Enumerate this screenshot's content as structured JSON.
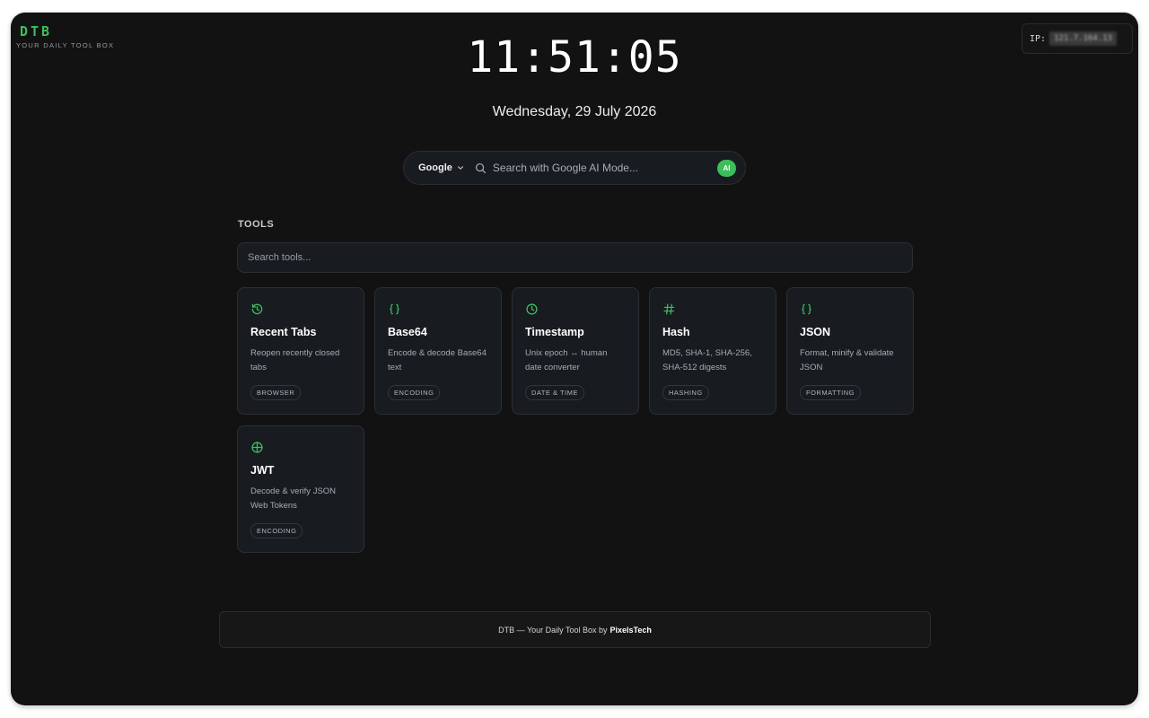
{
  "brand": {
    "name": "DTB",
    "tagline": "YOUR DAILY TOOL BOX"
  },
  "ip": {
    "label": "IP:",
    "value": "121.7.164.13"
  },
  "clock": {
    "time": "11:51:05",
    "date": "Wednesday, 29 July 2026"
  },
  "search": {
    "engine": "Google",
    "placeholder": "Search with Google AI Mode...",
    "ai_label": "AI"
  },
  "tools": {
    "section_label": "TOOLS",
    "search_placeholder": "Search tools...",
    "items": [
      {
        "title": "Recent Tabs",
        "description": "Reopen recently closed tabs",
        "tag": "BROWSER",
        "icon": "history-icon"
      },
      {
        "title": "Base64",
        "description": "Encode & decode Base64 text",
        "tag": "ENCODING",
        "icon": "braces-icon"
      },
      {
        "title": "Timestamp",
        "description": "Unix epoch ↔ human date converter",
        "tag": "DATE & TIME",
        "icon": "clock-icon"
      },
      {
        "title": "Hash",
        "description": "MD5, SHA-1, SHA-256, SHA-512 digests",
        "tag": "HASHING",
        "icon": "hash-icon"
      },
      {
        "title": "JSON",
        "description": "Format, minify & validate JSON",
        "tag": "FORMATTING",
        "icon": "braces-icon"
      },
      {
        "title": "JWT",
        "description": "Decode & verify JSON Web Tokens",
        "tag": "ENCODING",
        "icon": "globe-icon"
      }
    ]
  },
  "footer": {
    "text": "DTB — Your Daily Tool Box by",
    "brand": "PixelsTech"
  },
  "colors": {
    "accent": "#3cbf5a",
    "background": "#121212",
    "card": "#181b20"
  }
}
